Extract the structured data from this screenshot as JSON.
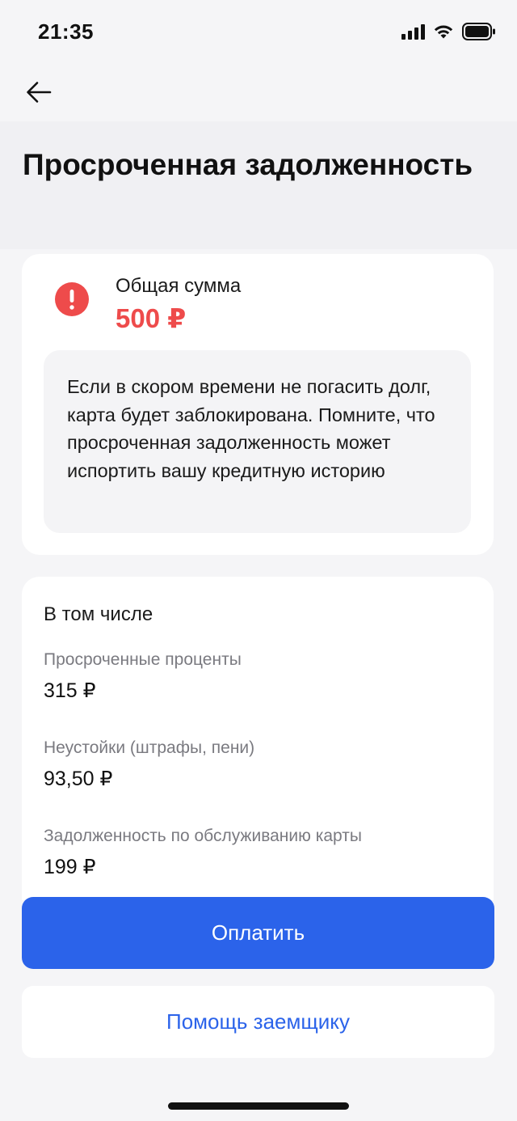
{
  "status_bar": {
    "time": "21:35"
  },
  "header": {
    "title": "Просроченная задолженность"
  },
  "summary": {
    "total_label": "Общая сумма",
    "total_amount": "500 ₽",
    "warning_text": "Если в скором времени не погасить долг, карта будет заблокирована. Помните, что просроченная задолженность может испортить вашу кредитную историю"
  },
  "details": {
    "title": "В том числе",
    "items": [
      {
        "label": "Просроченные проценты",
        "value": "315 ₽"
      },
      {
        "label": "Неустойки (штрафы, пени)",
        "value": "93,50 ₽"
      },
      {
        "label": "Задолженность по обслуживанию карты",
        "value": "199 ₽"
      }
    ]
  },
  "actions": {
    "pay_label": "Оплатить",
    "help_label": "Помощь заемщику"
  },
  "colors": {
    "accent": "#2b63ea",
    "danger": "#ee4b4b"
  },
  "icons": {
    "back": "arrow-left-icon",
    "alert": "exclamation-circle-icon",
    "signal": "cellular-signal-icon",
    "wifi": "wifi-icon",
    "battery": "battery-icon"
  }
}
